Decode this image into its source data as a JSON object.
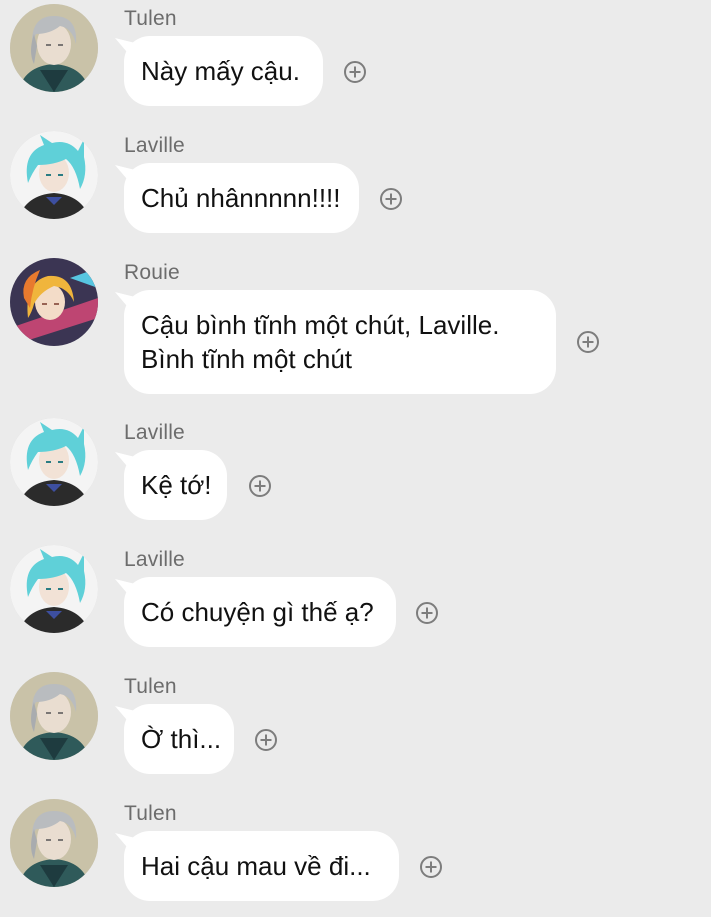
{
  "messages": [
    {
      "sender": "Tulen",
      "lines": [
        "Này mấy cậu."
      ],
      "avatar": "tulen-avatar",
      "action": "add-reaction-icon"
    },
    {
      "sender": "Laville",
      "lines": [
        "Chủ nhânnnnn!!!!"
      ],
      "avatar": "laville-avatar",
      "action": "add-reaction-icon"
    },
    {
      "sender": "Rouie",
      "lines": [
        "Cậu bình tĩnh một chút, Laville.",
        "Bình tĩnh một chút"
      ],
      "avatar": "rouie-avatar",
      "action": "add-reaction-icon"
    },
    {
      "sender": "Laville",
      "lines": [
        "Kệ tớ!"
      ],
      "avatar": "laville-avatar",
      "action": "add-reaction-icon"
    },
    {
      "sender": "Laville",
      "lines": [
        "Có chuyện gì thế ạ?"
      ],
      "avatar": "laville-avatar",
      "action": "add-reaction-icon"
    },
    {
      "sender": "Tulen",
      "lines": [
        "Ờ thì..."
      ],
      "avatar": "tulen-avatar",
      "action": "add-reaction-icon"
    },
    {
      "sender": "Tulen",
      "lines": [
        "Hai cậu mau về đi..."
      ],
      "avatar": "tulen-avatar",
      "action": "add-reaction-icon"
    }
  ],
  "colors": {
    "background": "#ebebeb",
    "bubble": "#ffffff",
    "sender_name": "#6c6c6c",
    "message_text": "#111111",
    "plus_icon": "#7d7d7d"
  }
}
